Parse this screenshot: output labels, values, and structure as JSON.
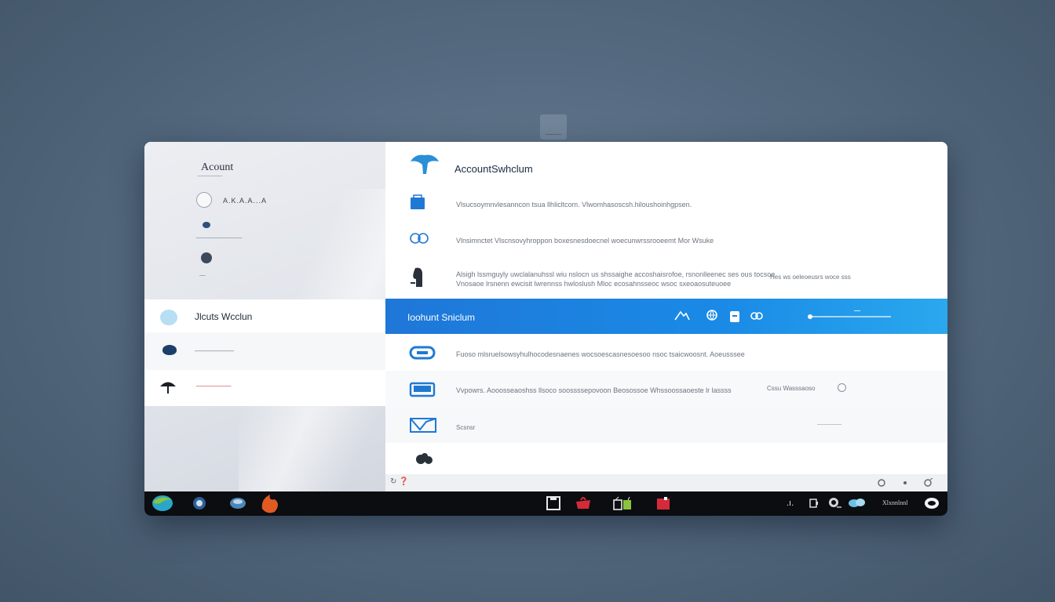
{
  "ghost_label": "–––––",
  "sidebar": {
    "brand": "Acount",
    "brand_subtitle": "––––––––",
    "profile_name": "A.K.A.A...A",
    "profile_detail": "–––––––––––––––",
    "profile_small": "––",
    "menu": [
      {
        "label": "Jlcuts Wcclun",
        "icon": "circle-icon"
      },
      {
        "label": "––––––––––",
        "icon": "bird-icon"
      },
      {
        "label": "––––––––––",
        "icon": "umbrella-icon"
      }
    ]
  },
  "header": {
    "title": "AccountSwhclum",
    "icon": "bird-logo-icon"
  },
  "rows": [
    {
      "icon": "folder-icon",
      "text": "Vlsucsoymnvlesanncon tsua llhlicltcom. Vlwomhasoscsh.hiloushoinhgpsen."
    },
    {
      "icon": "people-icon",
      "text": "Vlnsimnctet Vlscnsovyhroppon boxesnesdoecnel woecunwrssrooeemt Mor Wsuke"
    },
    {
      "icon": "person-icon",
      "text": "Alsigh lssmguyly uwclalanuhssl wiu nslocn us shssaighe accoshaisrofoe, rsnonlleenec ses ous tocsoe",
      "text2": "Vnosaoe lrsnenn ewcisit lwrennss hwloslush Mloc ecosahnsseoc wsoc sxeoaosuteuoee",
      "text3": "Hes ws oeleoeusrs woce sss"
    },
    {
      "icon": "gamepad-icon",
      "text": "Fuoso mlsruelsowsyhulhocodesnaenes wocsoescasnesoesoo nsoc tsaicwoosnt. Aoeusssee"
    },
    {
      "icon": "briefcase-icon",
      "text": "Vvpowrs. Aooosseaoshss llsoco soossssepovoon Beosossoe Whssoossaoeste lr lassss",
      "text2": "Cssu Wasssaoso",
      "badge_icon": "ring-icon"
    },
    {
      "icon": "mail-icon",
      "text": "Scsnsr",
      "text2": "––––––––"
    },
    {
      "icon": "gear-icon",
      "text": ""
    }
  ],
  "selected_row": {
    "label": "Ioohunt Sniclum",
    "icons": [
      "mountain-icon",
      "globe-icon",
      "bag-icon",
      "link-icon"
    ]
  },
  "status_bar": {
    "left": "↻ ❓",
    "right_icons": [
      "settings-icon",
      "help-icon",
      "info-icon"
    ]
  },
  "taskbar": {
    "left_icons": [
      "browser-icon",
      "mail-icon",
      "gamepad-icon",
      "fire-icon"
    ],
    "center_icons": [
      "window-icon",
      "shop-icon",
      "store-icon",
      "flag-icon"
    ],
    "tray_icons": [
      "signal-icon",
      "battery-icon",
      "volume-icon",
      "cloud-icon"
    ],
    "clock": "Xlxnnlnnl"
  },
  "colors": {
    "accent": "#1a8ae6",
    "accent_light": "#2aa8ee",
    "icon_blue": "#1f79d4",
    "taskbar": "#0b0d10"
  }
}
